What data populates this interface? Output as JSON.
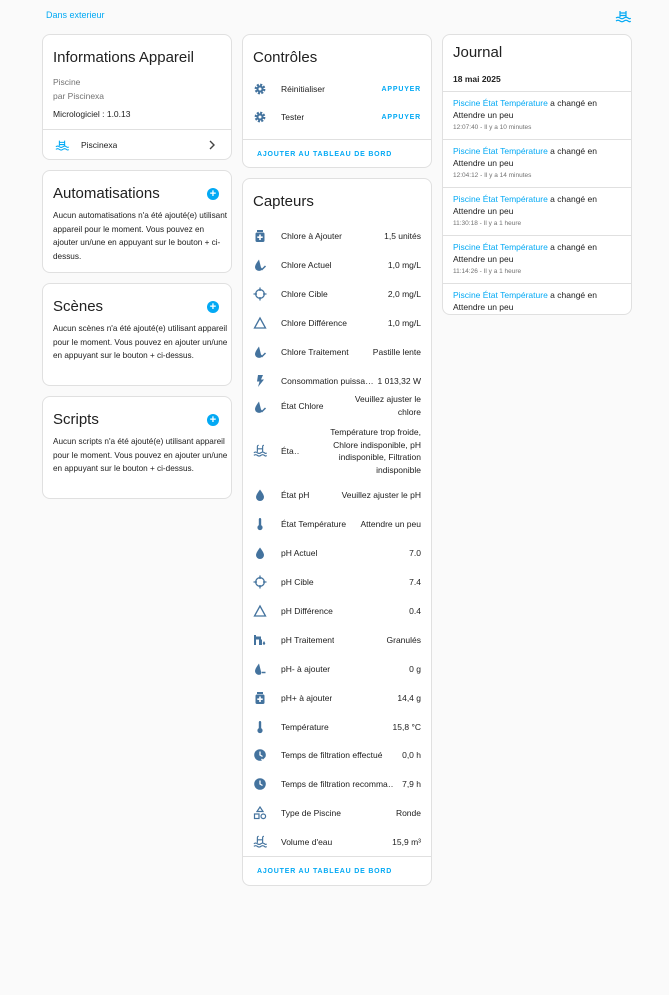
{
  "topbar": {
    "area_link": "Dans exterieur"
  },
  "device_info": {
    "title": "Informations Appareil",
    "model": "Piscine",
    "manufacturer": "par Piscinexa",
    "firmware": "Micrologiciel : 1.0.13",
    "integration_label": "Piscinexa"
  },
  "automations": {
    "title": "Automatisations",
    "text": "Aucun automatisations n'a été ajouté(e) utilisant appareil pour le moment. Vous pouvez en ajouter un/une en appuyant sur le bouton + ci-dessus."
  },
  "scenes": {
    "title": "Scènes",
    "text": "Aucun scènes n'a été ajouté(e) utilisant appareil pour le moment. Vous pouvez en ajouter un/une en appuyant sur le bouton + ci-dessus."
  },
  "scripts": {
    "title": "Scripts",
    "text": "Aucun scripts n'a été ajouté(e) utilisant appareil pour le moment. Vous pouvez en ajouter un/une en appuyant sur le bouton + ci-dessus."
  },
  "controls": {
    "title": "Contrôles",
    "items": [
      {
        "name": "Réinitialiser",
        "action": "APPUYER",
        "icon": "gear-icon"
      },
      {
        "name": "Tester",
        "action": "APPUYER",
        "icon": "gear-icon"
      }
    ],
    "add_dashboard": "AJOUTER AU TABLEAU DE BORD"
  },
  "sensors": {
    "title": "Capteurs",
    "items": [
      {
        "name": "Chlore à Ajouter",
        "value": "1,5 unités",
        "icon": "medical-bottle-icon"
      },
      {
        "name": "Chlore Actuel",
        "value": "1,0 mg/L",
        "icon": "water-check-icon"
      },
      {
        "name": "Chlore Cible",
        "value": "2,0 mg/L",
        "icon": "crosshairs-icon"
      },
      {
        "name": "Chlore Différence",
        "value": "1,0 mg/L",
        "icon": "delta-icon"
      },
      {
        "name": "Chlore Traitement",
        "value": "Pastille lente",
        "icon": "water-check-icon"
      },
      {
        "name": "Consommation puissa…",
        "value": "1 013,32 W",
        "icon": "flash-icon"
      },
      {
        "name": "État Chlore",
        "value": "Veuillez ajuster le chlore",
        "icon": "water-check-icon"
      },
      {
        "name": "Éta…",
        "value": "Température trop froide, Chlore indisponible, pH indisponible, Filtration indisponible",
        "icon": "pool-icon"
      },
      {
        "name": "État pH",
        "value": "Veuillez ajuster le pH",
        "icon": "water-drop-icon"
      },
      {
        "name": "État Température",
        "value": "Attendre un peu",
        "icon": "thermometer-icon"
      },
      {
        "name": "pH Actuel",
        "value": "7.0",
        "icon": "water-drop-icon"
      },
      {
        "name": "pH Cible",
        "value": "7.4",
        "icon": "crosshairs-icon"
      },
      {
        "name": "pH Différence",
        "value": "0.4",
        "icon": "delta-icon"
      },
      {
        "name": "pH Traitement",
        "value": "Granulés",
        "icon": "water-pump-icon"
      },
      {
        "name": "pH- à ajouter",
        "value": "0 g",
        "icon": "water-minus-icon"
      },
      {
        "name": "pH+ à ajouter",
        "value": "14,4 g",
        "icon": "medical-bottle-icon"
      },
      {
        "name": "Température",
        "value": "15,8 °C",
        "icon": "thermometer-icon"
      },
      {
        "name": "Temps de filtration effectué",
        "value": "0,0 h",
        "icon": "clock-check-icon"
      },
      {
        "name": "Temps de filtration recomma…",
        "value": "7,9 h",
        "icon": "clock-icon"
      },
      {
        "name": "Type de Piscine",
        "value": "Ronde",
        "icon": "shapes-icon"
      },
      {
        "name": "Volume d'eau",
        "value": "15,9 m³",
        "icon": "pool-icon"
      }
    ],
    "add_dashboard": "AJOUTER AU TABLEAU DE BORD"
  },
  "journal": {
    "title": "Journal",
    "date": "18 mai 2025",
    "entries": [
      {
        "entity": "Piscine État Température",
        "text": " a changé en Attendre un peu",
        "time": "12:07:40 - Il y a 10 minutes"
      },
      {
        "entity": "Piscine État Température",
        "text": " a changé en Attendre un peu",
        "time": "12:04:12 - Il y a 14 minutes"
      },
      {
        "entity": "Piscine État Température",
        "text": " a changé en Attendre un peu",
        "time": "11:30:18 - Il y a 1 heure"
      },
      {
        "entity": "Piscine État Température",
        "text": " a changé en Attendre un peu",
        "time": "11:14:26 - Il y a 1 heure"
      },
      {
        "entity": "Piscine État Température",
        "text": " a changé en Attendre un peu",
        "time": ""
      }
    ]
  },
  "colors": {
    "accent": "#03a9f4",
    "icon": "#44739e",
    "divider": "#e0e0e0",
    "secondary_text": "#727272"
  }
}
